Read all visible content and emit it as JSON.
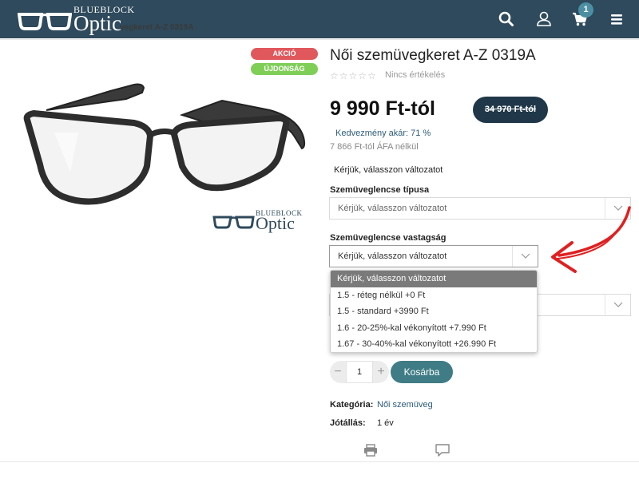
{
  "header": {
    "logo_top": "BLUEBLOCK",
    "logo_main": "Optic",
    "cart_count": "1",
    "icons": [
      "search-icon",
      "user-icon",
      "cart-icon",
      "menu-icon"
    ],
    "bg_color": "#2e4a5c"
  },
  "breadcrumb": {
    "tail": "vegkeret A-Z 0319A"
  },
  "tags": {
    "sale": "AKCIÓ",
    "new": "ÚJDONSÁG"
  },
  "image_logo": {
    "top": "BLUEBLOCK",
    "main": "Optic"
  },
  "product": {
    "title": "Női szemüvegkeret A-Z 0319A",
    "rating_stars": "☆☆☆☆☆",
    "rating_text": "Nincs értékelés",
    "price": "9 990 Ft-tól",
    "old_price": "34 970 Ft-tól",
    "discount": "Kedvezmény akár: 71 %",
    "net_price": "7 866 Ft-tól ÁFA nélkül",
    "choose_note": "Kérjük, válasszon változatot"
  },
  "options": {
    "lens_type_label": "Szemüveglencse típusa",
    "lens_type_value": "Kérjük, válasszon változatot",
    "lens_thickness_label": "Szemüveglencse vastagság",
    "lens_thickness_value": "Kérjük, válasszon változatot"
  },
  "dropdown": {
    "items": [
      "Kérjük, válasszon változatot",
      "1.5 - réteg nélkül +0 Ft",
      "1.5 - standard +3990 Ft",
      "1.6 - 20-25%-kal vékonyított +7.990 Ft",
      "1.67 - 30-40%-kal vékonyított +26.990 Ft"
    ],
    "selected_index": 0
  },
  "cart": {
    "quantity": "1",
    "button_label": "Kosárba",
    "minus": "−",
    "plus": "+"
  },
  "meta": {
    "category_label": "Kategória:",
    "category_value": "Női szemüveg",
    "warranty_label": "Jótállás:",
    "warranty_value": "1 év"
  },
  "colors": {
    "accent": "#3f7c86",
    "sale_tag": "#e0585c",
    "new_tag": "#7fce57",
    "annotation": "#e02020"
  }
}
